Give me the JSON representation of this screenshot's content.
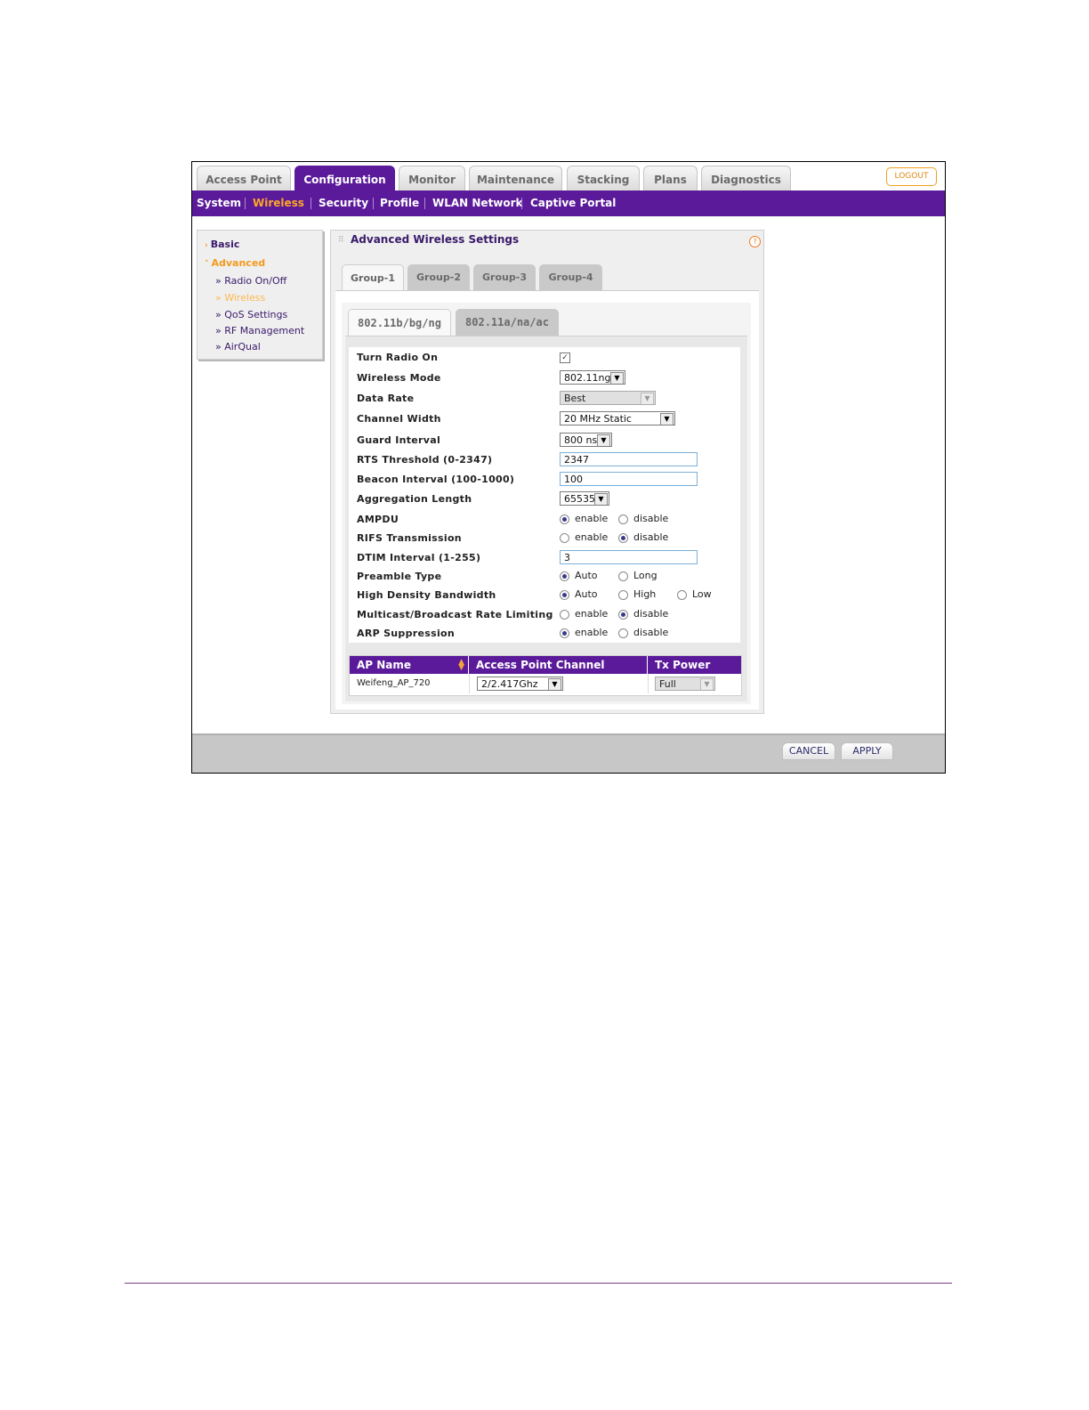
{
  "top_tabs": [
    "Access Point",
    "Configuration",
    "Monitor",
    "Maintenance",
    "Stacking",
    "Plans",
    "Diagnostics"
  ],
  "active_top_tab": "Configuration",
  "logout_label": "LOGOUT",
  "subnav": [
    "System",
    "Wireless",
    "Security",
    "Profile",
    "WLAN Network",
    "Captive Portal"
  ],
  "active_subnav": "Wireless",
  "sidebar": {
    "basic": "Basic",
    "advanced": "Advanced",
    "items": [
      "» Radio On/Off",
      "» Wireless",
      "» QoS Settings",
      "» RF Management",
      "» AirQual"
    ],
    "active_item": "» Wireless"
  },
  "panel": {
    "title": "Advanced Wireless Settings",
    "help_icon": "?",
    "group_tabs": [
      "Group-1",
      "Group-2",
      "Group-3",
      "Group-4"
    ],
    "active_group": "Group-1",
    "band_tabs": [
      "802.11b/bg/ng",
      "802.11a/na/ac"
    ],
    "active_band": "802.11b/bg/ng"
  },
  "settings": {
    "turn_radio_on": {
      "label": "Turn Radio On",
      "checked": true,
      "mark": "✓"
    },
    "wireless_mode": {
      "label": "Wireless Mode",
      "value": "802.11ng"
    },
    "data_rate": {
      "label": "Data Rate",
      "value": "Best"
    },
    "channel_width": {
      "label": "Channel Width",
      "value": "20 MHz Static"
    },
    "guard_interval": {
      "label": "Guard Interval",
      "value": "800 ns"
    },
    "rts_threshold": {
      "label": "RTS Threshold (0-2347)",
      "value": "2347"
    },
    "beacon_interval": {
      "label": "Beacon Interval (100-1000)",
      "value": "100"
    },
    "aggregation_length": {
      "label": "Aggregation Length",
      "value": "65535"
    },
    "ampdu": {
      "label": "AMPDU",
      "options": [
        "enable",
        "disable"
      ],
      "selected": "enable"
    },
    "rifs": {
      "label": "RIFS Transmission",
      "options": [
        "enable",
        "disable"
      ],
      "selected": "disable"
    },
    "dtim": {
      "label": "DTIM Interval (1-255)",
      "value": "3"
    },
    "preamble": {
      "label": "Preamble Type",
      "options": [
        "Auto",
        "Long"
      ],
      "selected": "Auto"
    },
    "high_density": {
      "label": "High Density Bandwidth",
      "options": [
        "Auto",
        "High",
        "Low"
      ],
      "selected": "Auto"
    },
    "multicast": {
      "label": "Multicast/Broadcast Rate Limiting",
      "options": [
        "enable",
        "disable"
      ],
      "selected": "disable"
    },
    "arp": {
      "label": "ARP Suppression",
      "options": [
        "enable",
        "disable"
      ],
      "selected": "enable"
    }
  },
  "ap_table": {
    "headers": [
      "AP Name",
      "Access Point Channel",
      "Tx Power"
    ],
    "rows": [
      {
        "ap_name": "Weifeng_AP_720",
        "channel": "2/2.417Ghz",
        "tx_power": "Full"
      }
    ]
  },
  "footer": {
    "cancel": "CANCEL",
    "apply": "APPLY"
  },
  "colors": {
    "brand_purple": "#5a1a9a",
    "accent_orange": "#f29a1d"
  }
}
